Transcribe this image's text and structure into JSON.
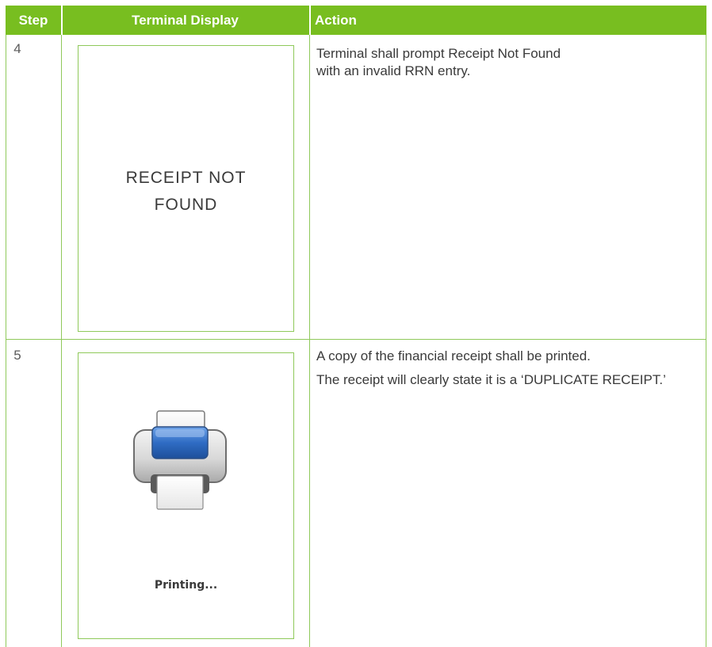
{
  "table": {
    "headers": {
      "step": "Step",
      "display": "Terminal Display",
      "action": "Action"
    },
    "rows": [
      {
        "step": "4",
        "display_lines": [
          "RECEIPT NOT",
          "FOUND"
        ],
        "action_lines": [
          "Terminal shall prompt Receipt Not Found",
          "with an invalid RRN entry."
        ]
      },
      {
        "step": "5",
        "display_caption": "Printing...",
        "display_icon": "printer-icon",
        "action_paragraphs": [
          "A copy of the financial receipt shall be printed.",
          "The receipt will clearly state it is a ‘DUPLICATE RECEIPT.’"
        ]
      }
    ]
  },
  "colors": {
    "header_bg": "#78be20",
    "header_text": "#ffffff",
    "grid": "#8fc95a",
    "body_text": "#3a3a3a",
    "printer_blue": "#2f6cc4"
  }
}
